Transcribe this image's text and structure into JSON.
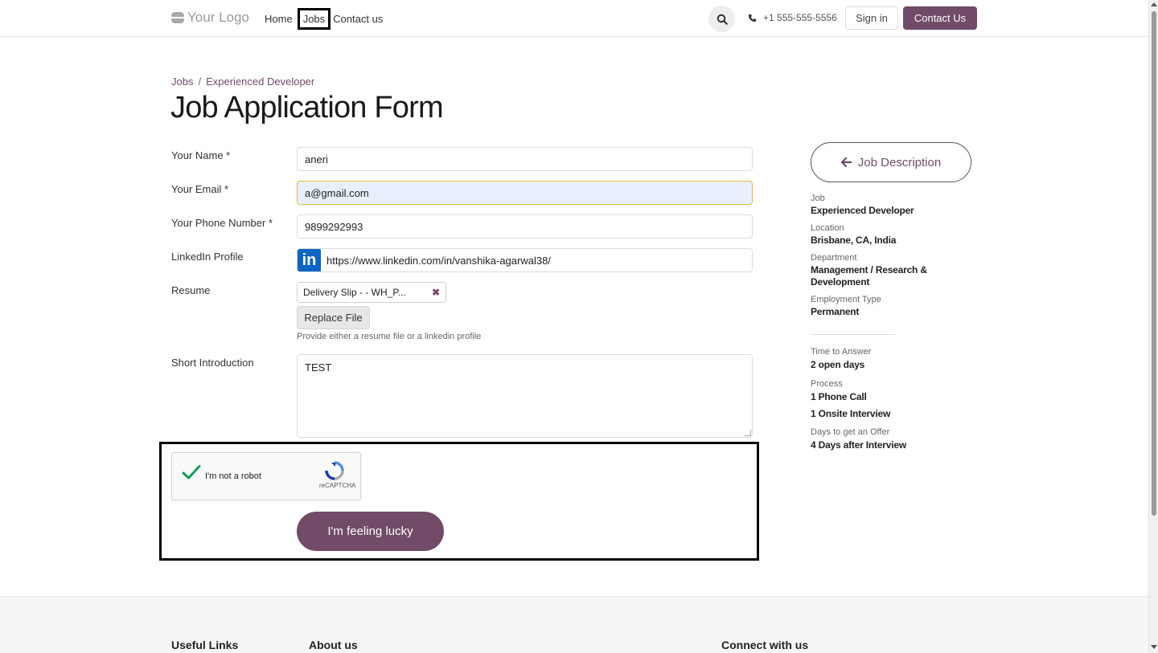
{
  "header": {
    "logo_text": "Your Logo",
    "nav": [
      {
        "label": "Home"
      },
      {
        "label": "Jobs",
        "active": true
      },
      {
        "label": "Contact us"
      }
    ],
    "phone": "+1 555-555-5556",
    "sign_in": "Sign in",
    "contact_button": "Contact Us"
  },
  "breadcrumb": {
    "root": "Jobs",
    "separator": "/",
    "current": "Experienced Developer"
  },
  "title": "Job Application Form",
  "form": {
    "name_label": "Your Name *",
    "name_value": "aneri",
    "email_label": "Your Email *",
    "email_value": "a@gmail.com",
    "phone_label": "Your Phone Number *",
    "phone_value": "9899292993",
    "linkedin_label": "LinkedIn Profile",
    "linkedin_badge": "in",
    "linkedin_value": "https://www.linkedin.com/in/vanshika-agarwal38/",
    "resume_label": "Resume",
    "resume_file": "Delivery Slip - - WH_P...",
    "replace_file": "Replace File",
    "resume_hint": "Provide either a resume file or a linkedin profile",
    "intro_label": "Short Introduction",
    "intro_value": "TEST",
    "recaptcha_text": "I'm not a robot",
    "recaptcha_brand": "reCAPTCHA",
    "submit": "I'm feeling lucky"
  },
  "sidebar": {
    "job_description_button": "Job Description",
    "job_label": "Job",
    "job_value": "Experienced Developer",
    "location_label": "Location",
    "location_value": "Brisbane, CA, India",
    "department_label": "Department",
    "department_value": "Management / Research & Development",
    "employment_label": "Employment Type",
    "employment_value": "Permanent",
    "time_label": "Time to Answer",
    "time_value": "2 open days",
    "process_label": "Process",
    "process_items": [
      "1 Phone Call",
      "1 Onsite Interview"
    ],
    "offer_label": "Days to get an Offer",
    "offer_value": "4 Days after Interview"
  },
  "footer": {
    "useful_links": "Useful Links",
    "about_us": "About us",
    "connect": "Connect with us"
  },
  "colors": {
    "brand": "#714b67",
    "autofill_bg": "#e8f0fe",
    "linkedin_blue": "#0a66c2"
  }
}
